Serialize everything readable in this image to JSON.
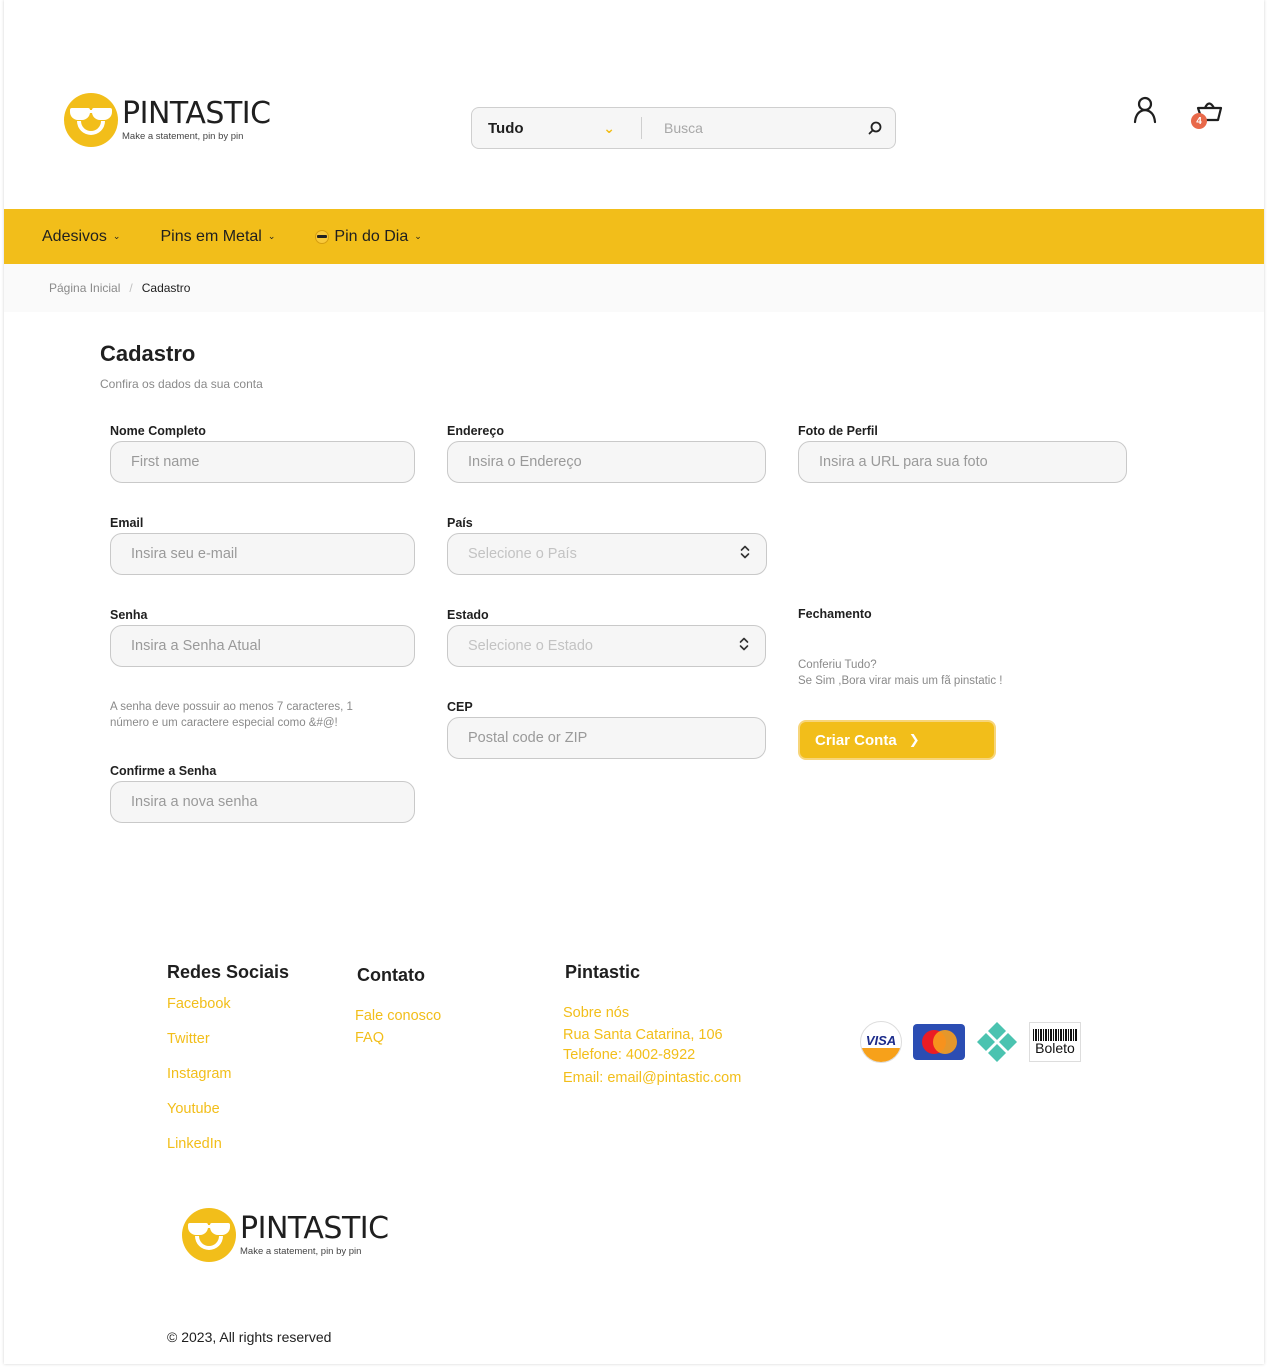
{
  "header": {
    "brand": "PINTASTIC",
    "tagline": "Make a statement, pin by pin",
    "search": {
      "category": "Tudo",
      "placeholder": "Busca"
    },
    "cart_count": "4"
  },
  "nav": {
    "items": [
      {
        "label": "Adesivos"
      },
      {
        "label": "Pins em Metal"
      },
      {
        "label": "Pin do Dia"
      }
    ]
  },
  "breadcrumb": {
    "home": "Página Inicial",
    "separator": "/",
    "current": "Cadastro"
  },
  "form": {
    "title": "Cadastro",
    "subtitle": "Confira os dados da sua conta",
    "fields": {
      "name": {
        "label": "Nome Completo",
        "placeholder": "First name"
      },
      "email": {
        "label": "Email",
        "placeholder": "Insira seu e-mail"
      },
      "password": {
        "label": "Senha",
        "placeholder": "Insira a Senha Atual"
      },
      "password_hint": "A senha deve possuir ao menos 7 caracteres, 1 número e um caractere especial como &#@!",
      "confirm": {
        "label": "Confirme a Senha",
        "placeholder": "Insira a nova senha"
      },
      "address": {
        "label": "Endereço",
        "placeholder": "Insira o Endereço"
      },
      "country": {
        "label": "País",
        "value": "Selecione o País"
      },
      "state": {
        "label": "Estado",
        "value": "Selecione o Estado"
      },
      "zip": {
        "label": "CEP",
        "placeholder": "Postal code or ZIP"
      },
      "photo": {
        "label": "Foto de Perfil",
        "placeholder": "Insira a URL para sua foto"
      }
    },
    "closing": {
      "label": "Fechamento",
      "line1": "Conferiu Tudo?",
      "line2": "Se Sim ,Bora virar mais um fã pinstatic !"
    },
    "submit_label": "Criar Conta"
  },
  "footer": {
    "social": {
      "title": "Redes Sociais",
      "links": [
        "Facebook",
        "Twitter",
        "Instagram",
        "Youtube",
        "LinkedIn"
      ]
    },
    "contact": {
      "title": "Contato",
      "links": [
        "Fale conosco",
        "FAQ"
      ]
    },
    "company": {
      "title": "Pintastic",
      "links": [
        "Sobre nós",
        "Rua Santa Catarina, 106",
        "Telefone: 4002-8922",
        "Email: email@pintastic.com"
      ]
    },
    "payments": {
      "visa": "VISA",
      "boleto": "Boleto",
      "icons": [
        "visa-icon",
        "mastercard-icon",
        "pix-icon",
        "boleto-icon"
      ]
    },
    "brand": "PINTASTIC",
    "tagline": "Make a statement, pin by pin",
    "copyright": "© 2023, All rights reserved"
  },
  "colors": {
    "accent": "#f2be1a",
    "badge": "#e8694a",
    "field_bg": "#f6f6f6",
    "breadcrumb_bg": "#fafafa"
  }
}
